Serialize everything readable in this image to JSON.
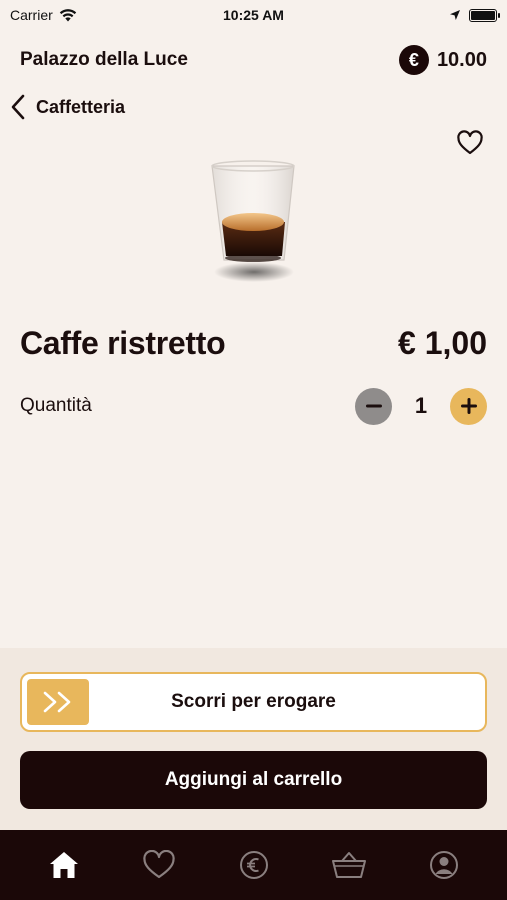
{
  "status_bar": {
    "carrier": "Carrier",
    "time": "10:25 AM"
  },
  "header": {
    "venue": "Palazzo della Luce",
    "currency_symbol": "€",
    "balance": "10.00"
  },
  "nav": {
    "back_label": "Caffetteria"
  },
  "product": {
    "name": "Caffe ristretto",
    "price": "€ 1,00",
    "favorite": false
  },
  "quantity": {
    "label": "Quantità",
    "value": "1"
  },
  "actions": {
    "slide_label": "Scorri per erogare",
    "add_to_cart_label": "Aggiungi al carrello"
  },
  "tab_bar": {
    "active": "home",
    "items": [
      "home-icon",
      "heart-icon",
      "euro-coin-icon",
      "basket-icon",
      "profile-icon"
    ]
  },
  "colors": {
    "accent": "#e8b75c",
    "dark": "#1b0808",
    "background": "#f7f1ec",
    "panel": "#f1e8e0",
    "minus_button": "#8f8c8b"
  }
}
